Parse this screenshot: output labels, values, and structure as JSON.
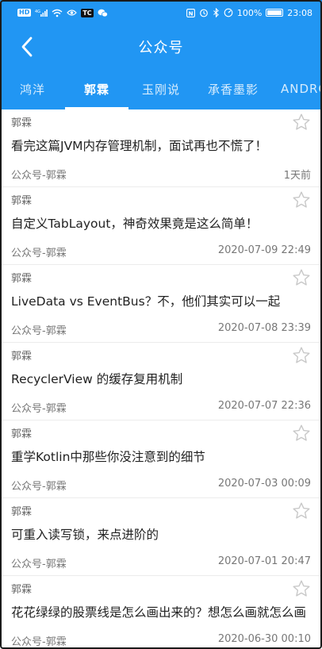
{
  "status_bar": {
    "hd": "HD",
    "signal": "4G",
    "tc": "TC",
    "nfc": "N",
    "battery_pct": "100%",
    "battery_level": 1.0,
    "time": "23:08"
  },
  "toolbar": {
    "title": "公众号"
  },
  "tabs": [
    {
      "label": "鸿洋",
      "active": false
    },
    {
      "label": "郭霖",
      "active": true
    },
    {
      "label": "玉刚说",
      "active": false
    },
    {
      "label": "承香墨影",
      "active": false
    },
    {
      "label": "ANDROID",
      "active": false
    }
  ],
  "articles": [
    {
      "author": "郭霖",
      "title": "看完这篇JVM内存管理机制，面试再也不慌了！",
      "source": "公众号-郭霖",
      "time": "1天前"
    },
    {
      "author": "郭霖",
      "title": "自定义TabLayout，神奇效果竟是这么简单！",
      "source": "公众号-郭霖",
      "time": "2020-07-09 22:49"
    },
    {
      "author": "郭霖",
      "title": "LiveData vs EventBus？不，他们其实可以一起",
      "source": "公众号-郭霖",
      "time": "2020-07-08 23:39"
    },
    {
      "author": "郭霖",
      "title": "RecyclerView 的缓存复用机制",
      "source": "公众号-郭霖",
      "time": "2020-07-07 22:36"
    },
    {
      "author": "郭霖",
      "title": "重学Kotlin中那些你没注意到的细节",
      "source": "公众号-郭霖",
      "time": "2020-07-03 00:09"
    },
    {
      "author": "郭霖",
      "title": "可重入读写锁，来点进阶的",
      "source": "公众号-郭霖",
      "time": "2020-07-01 20:47"
    },
    {
      "author": "郭霖",
      "title": "花花绿绿的股票线是怎么画出来的？想怎么画就怎么画",
      "source": "公众号-郭霖",
      "time": "2020-06-30 00:10"
    }
  ],
  "colors": {
    "primary": "#2196f3",
    "star_outline": "#c8c8c8"
  }
}
